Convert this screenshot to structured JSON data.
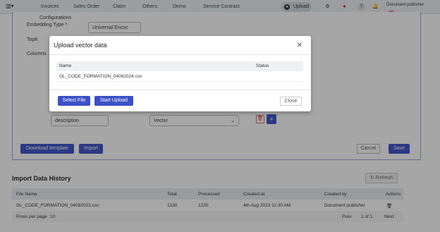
{
  "nav": {
    "items": [
      "Invoices",
      "Sales Order",
      "Claim",
      "Others",
      "Demo",
      "Service Contract"
    ],
    "upload_label": "Upload",
    "user_name": "Document publisher",
    "avatar_initials": "DP"
  },
  "form": {
    "configurations_label": "Configurations",
    "embedding_label": "Embedding Type *",
    "embedding_value": "Universal Encoc",
    "topk_label": "TopK",
    "columns_label": "Columns",
    "description_value": "description",
    "vector_value": "Vector",
    "download_template_label": "Download template",
    "import_label": "Import",
    "cancel_label": "Cancel",
    "save_label": "Save"
  },
  "history": {
    "title": "Import Data History",
    "refresh_label": "Refresh",
    "columns": [
      "File Name",
      "Total",
      "Processed",
      "Created at",
      "Created by",
      "Actions"
    ],
    "rows": [
      {
        "file": "GL_CODE_FORMATION_04082023.csv",
        "total": "1230",
        "processed": "1230",
        "created_at": "4th Aug 2023 11:30 AM",
        "created_by": "Document publisher"
      }
    ],
    "rows_per_page_label": "Rows per page",
    "rows_per_page_value": "10",
    "prev_label": "Prev",
    "page_label": "1 of 1",
    "next_label": "Next"
  },
  "modal": {
    "title": "Upload vector data",
    "columns": [
      "Name",
      "Status"
    ],
    "rows": [
      {
        "name": "GL_CODE_FORMATION_04082024.csv",
        "status": ""
      }
    ],
    "select_file_label": "Select File",
    "start_upload_label": "Start Upload",
    "close_label": "Close"
  }
}
